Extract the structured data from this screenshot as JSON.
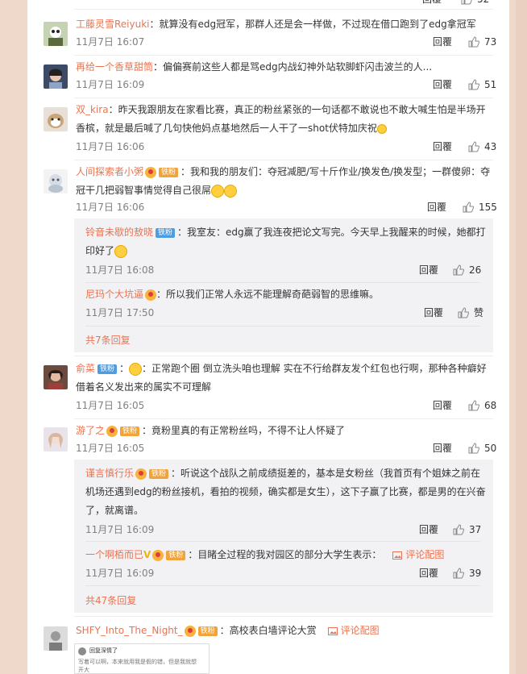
{
  "ui": {
    "reply": "回覆"
  },
  "comments": [
    {
      "name": "工藤灵雪Reiyuki",
      "text": "：就算没有edg冠军，那群人还是会一样做，不过现在借口跑到了edg拿冠军",
      "time": "11月7日 16:07",
      "likes": "73"
    },
    {
      "name": "再给一个香草甜筒",
      "text": "：偏偏赛前这些人都是骂edg内战幻神外站软脚虾闪击波兰的人...",
      "time": "11月7日 16:09",
      "likes": "51"
    },
    {
      "name": "双_kira",
      "text": "：昨天我跟朋友在家看比赛，真正的粉丝紧张的一句话都不敢说也不敢大喊生怕是半场开香槟，就是最后喊了几句快他妈点基地然后一人干了一shot伏特加庆祝",
      "time": "11月7日 16:06",
      "likes": "43"
    },
    {
      "name": "人间探索者小粥",
      "badge": "铁粉",
      "text": "：我和我的朋友们：夺冠减肥/写十斤作业/换发色/换发型；一群傻卵：夺冠干几把弱智事情觉得自己很屌",
      "time": "11月7日 16:06",
      "likes": "155"
    },
    {
      "name": "俞菜",
      "badge": "铁粉",
      "text": "：正常跑个圈 倒立洗头咱也理解 实在不行给群友发个红包也行啊，那种各种癖好借着名义发出来的属实不可理解",
      "time": "11月7日 16:05",
      "likes": "68"
    },
    {
      "name": "游了之",
      "badge": "铁粉",
      "text": "：竟粉里真的有正常粉丝吗，不得不让人怀疑了",
      "time": "11月7日 16:05",
      "likes": "50"
    },
    {
      "name": "SHFY_Into_The_Night_",
      "badge": "铁粉",
      "text": "：高校表白墙评论大赏",
      "pic_label": "评论配图"
    }
  ],
  "replies_a": [
    {
      "name": "铃音未歇的敖晓",
      "badge": "铁粉",
      "text": "：我室友：edg赢了我连夜把论文写完。今天早上我醒来的时候，她都打印好了",
      "time": "11月7日 16:08",
      "likes": "26"
    },
    {
      "name": "尼玛个大坑逼",
      "text": "：所以我们正常人永远不能理解奇葩弱智的思维嘛。",
      "time": "11月7日 17:50",
      "likes": "赞"
    }
  ],
  "more_a": "共7条回复",
  "replies_b": [
    {
      "name": "谨言慎行乐",
      "badge": "铁粉",
      "text": "：听说这个战队之前成绩挺差的，基本是女粉丝（我首页有个姐妹之前在机场还遇到edg的粉丝接机，看拍的视频，确实都是女生），这下子赢了比赛，都是男的在兴奋了，就离谱。",
      "time": "11月7日 16:09",
      "likes": "37"
    },
    {
      "name": "一个啊栢而已",
      "badge": "铁粉",
      "text": "：目睹全过程的我对园区的部分大学生表示：",
      "pic_label": "评论配图",
      "time": "11月7日 16:09",
      "likes": "39"
    }
  ],
  "more_b": "共47条回复",
  "thumb_text": [
    "回复深情了",
    "写着可以啊，本来就用我是假的错，但是我就想",
    "开大"
  ]
}
